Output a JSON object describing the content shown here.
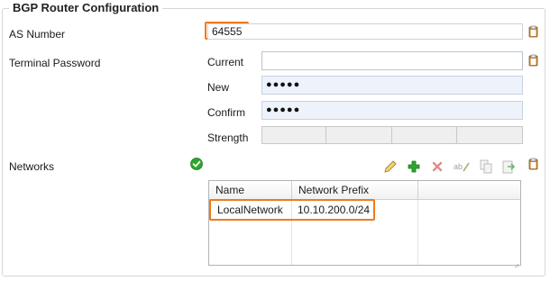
{
  "section": {
    "title": "BGP Router Configuration"
  },
  "as_number": {
    "label": "AS Number",
    "value": "64555"
  },
  "terminal_password": {
    "label": "Terminal Password",
    "current": {
      "label": "Current",
      "value": ""
    },
    "new": {
      "label": "New",
      "value": "●●●●●"
    },
    "confirm": {
      "label": "Confirm",
      "value": "●●●●●"
    },
    "strength": {
      "label": "Strength"
    }
  },
  "networks": {
    "label": "Networks",
    "status_icon": "green-check-icon",
    "toolbar": [
      "edit-pencil-icon",
      "add-plus-icon",
      "delete-x-icon",
      "rename-icon",
      "copy-icon",
      "paste-icon"
    ],
    "columns": [
      "Name",
      "Network Prefix"
    ],
    "rows": [
      {
        "name": "LocalNetwork",
        "prefix": "10.10.200.0/24"
      }
    ]
  },
  "colors": {
    "highlight": "#f07a1a",
    "accent_green": "#2fa52f",
    "delete_red": "#d23b3b"
  }
}
